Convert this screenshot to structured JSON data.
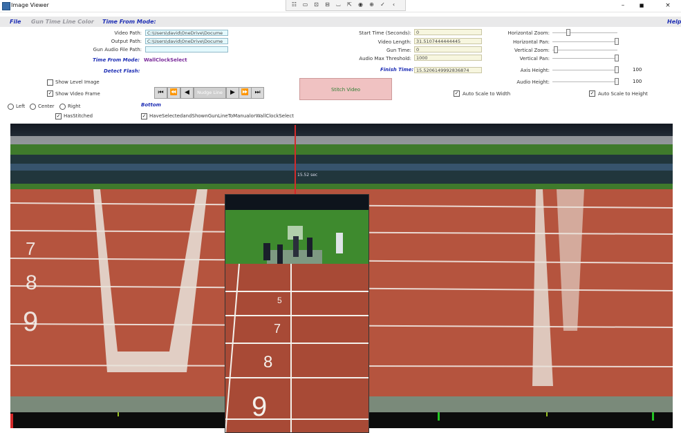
{
  "window": {
    "title": "Image Viewer"
  },
  "toolbar": {
    "tools": [
      {
        "name": "page-icon",
        "glyph": "☷"
      },
      {
        "name": "video-icon",
        "glyph": "▭"
      },
      {
        "name": "select-icon",
        "glyph": "⊡"
      },
      {
        "name": "tooltip-icon",
        "glyph": "⊟"
      },
      {
        "name": "frame-icon",
        "glyph": "⌴"
      },
      {
        "name": "pointer-icon",
        "glyph": "⇱"
      },
      {
        "name": "record-icon",
        "glyph": "◉"
      },
      {
        "name": "target-icon",
        "glyph": "⊕"
      },
      {
        "name": "check-icon",
        "glyph": "✓"
      },
      {
        "name": "back-icon",
        "glyph": "‹"
      }
    ],
    "window_buttons": {
      "minimize": "–",
      "maximize": "■",
      "close": "×"
    }
  },
  "menu": {
    "file": "File",
    "gun_color": "Gun Time Line Color",
    "time_mode": "Time From Mode:",
    "help": "Help"
  },
  "form": {
    "video_path_label": "Video Path:",
    "video_path": "C:\\Users\\david\\OneDrive\\Docume",
    "output_path_label": "Output Path:",
    "output_path": "C:\\Users\\david\\OneDrive\\Docume",
    "gun_audio_label": "Gun Audio File Path:",
    "gun_audio": "",
    "time_from_mode_label": "Time From Mode:",
    "time_from_mode_value": "WallClockSelect",
    "detect_flash_label": "Detect Flash:",
    "start_time_label": "Start Time (Seconds):",
    "start_time": "0",
    "video_length_label": "Video Length:",
    "video_length": "31.5107444444445",
    "gun_time_label": "Gun Time:",
    "gun_time": "0",
    "audio_threshold_label": "Audio Max Threshold:",
    "audio_threshold": "1000",
    "finish_time_label": "Finish Time:",
    "finish_time": "15.5206149992836874",
    "horizontal_zoom_label": "Horizontal Zoom:",
    "horizontal_pan_label": "Horizontal Pan:",
    "vertical_zoom_label": "Vertical Zoom:",
    "vertical_pan_label": "Vertical Pan:",
    "axis_height_label": "Axis Height:",
    "axis_height": "100",
    "audio_height_label": "Audio Height:",
    "audio_height": "100"
  },
  "sliders": {
    "horizontal_zoom": 0.22,
    "horizontal_pan": 1.0,
    "vertical_zoom": 0.02,
    "vertical_pan": 1.0,
    "axis_height": 1.0,
    "audio_height": 1.0
  },
  "options": {
    "show_level_image": "Show Level Image",
    "show_level_image_checked": false,
    "show_video_frame": "Show Video Frame",
    "show_video_frame_checked": true,
    "nudge_line": "Nudge Line",
    "stitch_video": "Stitch Video",
    "auto_scale_width": "Auto Scale to Width",
    "auto_scale_width_checked": true,
    "auto_scale_height": "Auto Scale to Height",
    "auto_scale_height_checked": true,
    "align_left": "Left",
    "align_center": "Center",
    "align_right": "Right",
    "has_stitched": "HasStitched",
    "has_stitched_checked": true,
    "bottom_label": "Bottom",
    "have_selected": "HaveSelectedandShownGunLineToManualorWallClockSelect",
    "have_selected_checked": true
  },
  "nav": {
    "first": "⏮",
    "prev_fast": "⏪",
    "prev": "◀",
    "next": "▶",
    "next_fast": "⏩",
    "last": "⏭"
  },
  "image": {
    "time_marker": "15.52 sec"
  },
  "colors": {
    "accent_blue": "#1f2fb5",
    "purple": "#7a2a9a",
    "gun_line": "#d42a2a",
    "track": "#b5543e",
    "grass": "#3f7a2c"
  }
}
